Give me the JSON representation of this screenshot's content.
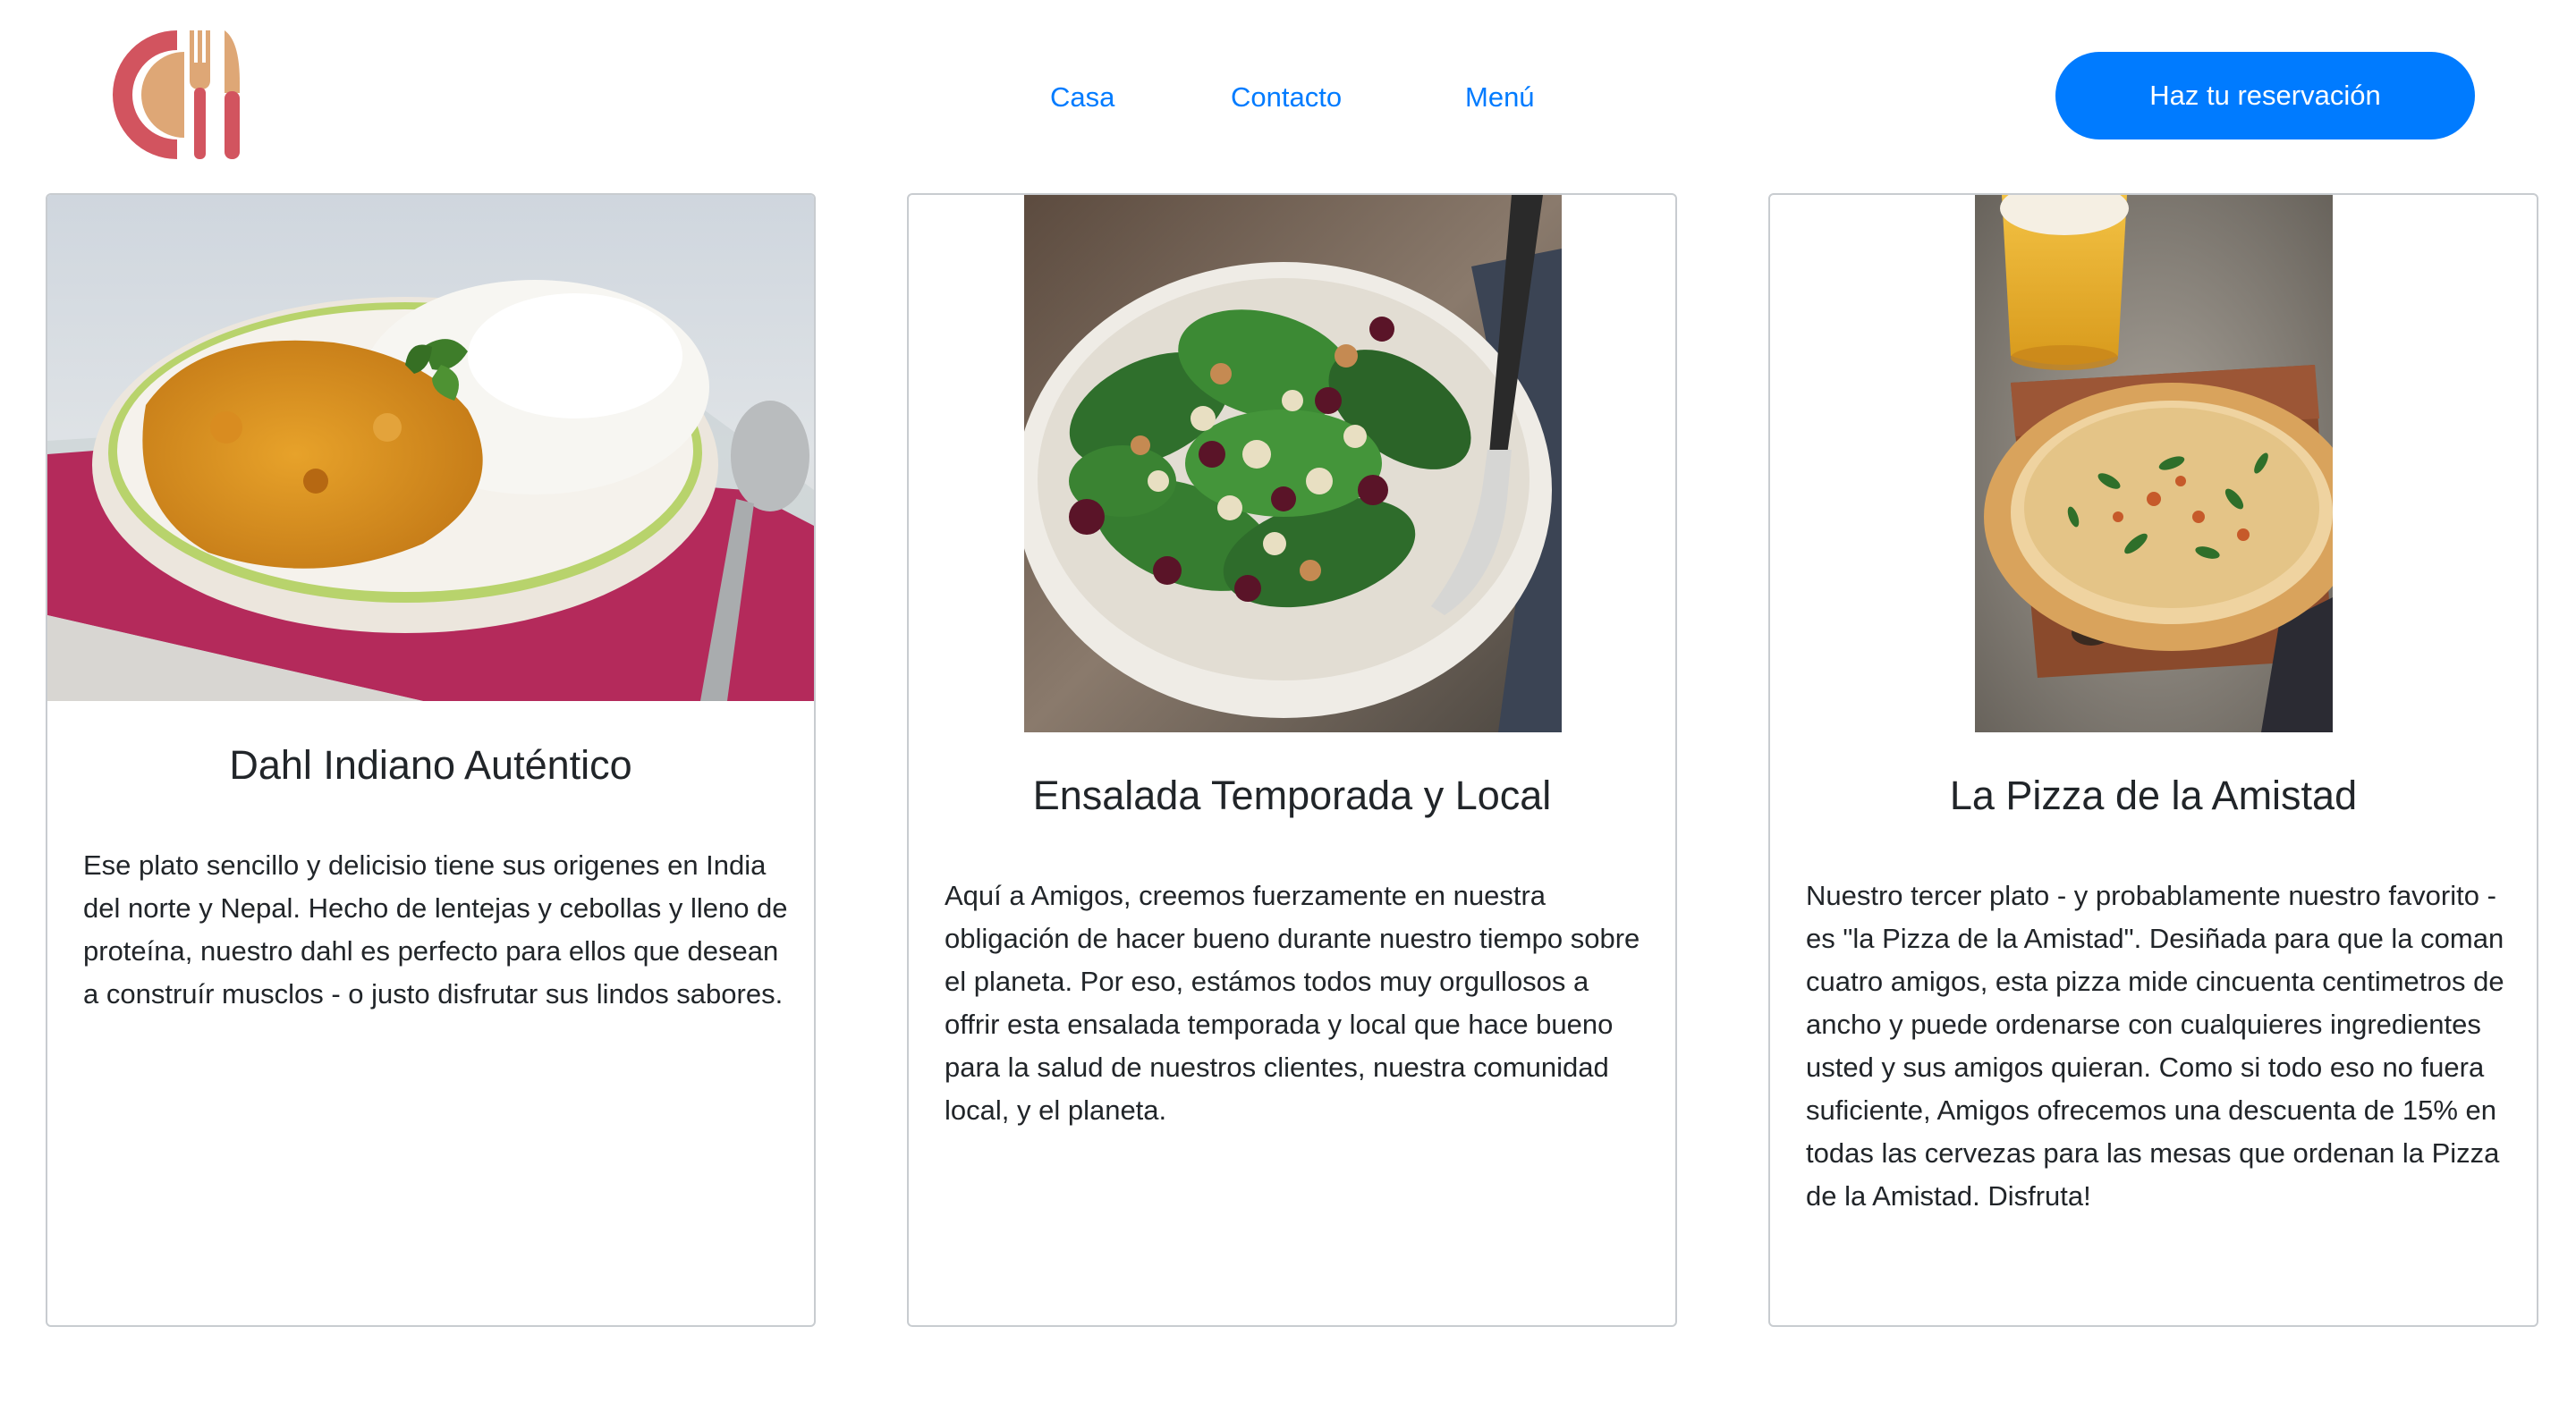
{
  "brand": {
    "logo_icon": "plate-fork-knife-logo",
    "logo_colors": [
      "#d2545f",
      "#dea776"
    ]
  },
  "nav": {
    "items": [
      {
        "label": "Casa"
      },
      {
        "label": "Contacto"
      },
      {
        "label": "Menú"
      }
    ],
    "link_color": "#007bff"
  },
  "header": {
    "reserve_label": "Haz tu reservación",
    "reserve_color": "#007bff"
  },
  "cards": [
    {
      "image_icon": "dahl-bowl-photo",
      "title": "Dahl Indiano Auténtico",
      "text": "Ese plato sencillo y delicisio tiene sus origenes en India del norte y Nepal. Hecho de lentejas y cebollas y lleno de proteína, nuestro dahl es perfecto para ellos que desean a construír musclos - o justo disfrutar sus lindos sabores."
    },
    {
      "image_icon": "salad-bowl-photo",
      "title": "Ensalada Temporada y Local",
      "text": "Aquí a Amigos, creemos fuerzamente en nuestra obligación de hacer bueno durante nuestro tiempo sobre el planeta. Por eso, estámos todos muy orgullosos a offrir esta ensalada temporada y local que hace bueno para la salud de nuestros clientes, nuestra comunidad local, y el planeta."
    },
    {
      "image_icon": "pizza-beer-photo",
      "title": "La Pizza de la Amistad",
      "text": "Nuestro tercer plato - y probablamente nuestro favorito - es \"la Pizza de la Amistad\". Desiñada para que la coman cuatro amigos, esta pizza mide cincuenta centimetros de ancho y puede ordenarse con cualquieres ingredientes usted y sus amigos quieran. Como si todo eso no fuera suficiente, Amigos ofrecemos una descuenta de 15% en todas las cervezas para las mesas que ordenan la Pizza de la Amistad. Disfruta!"
    }
  ]
}
